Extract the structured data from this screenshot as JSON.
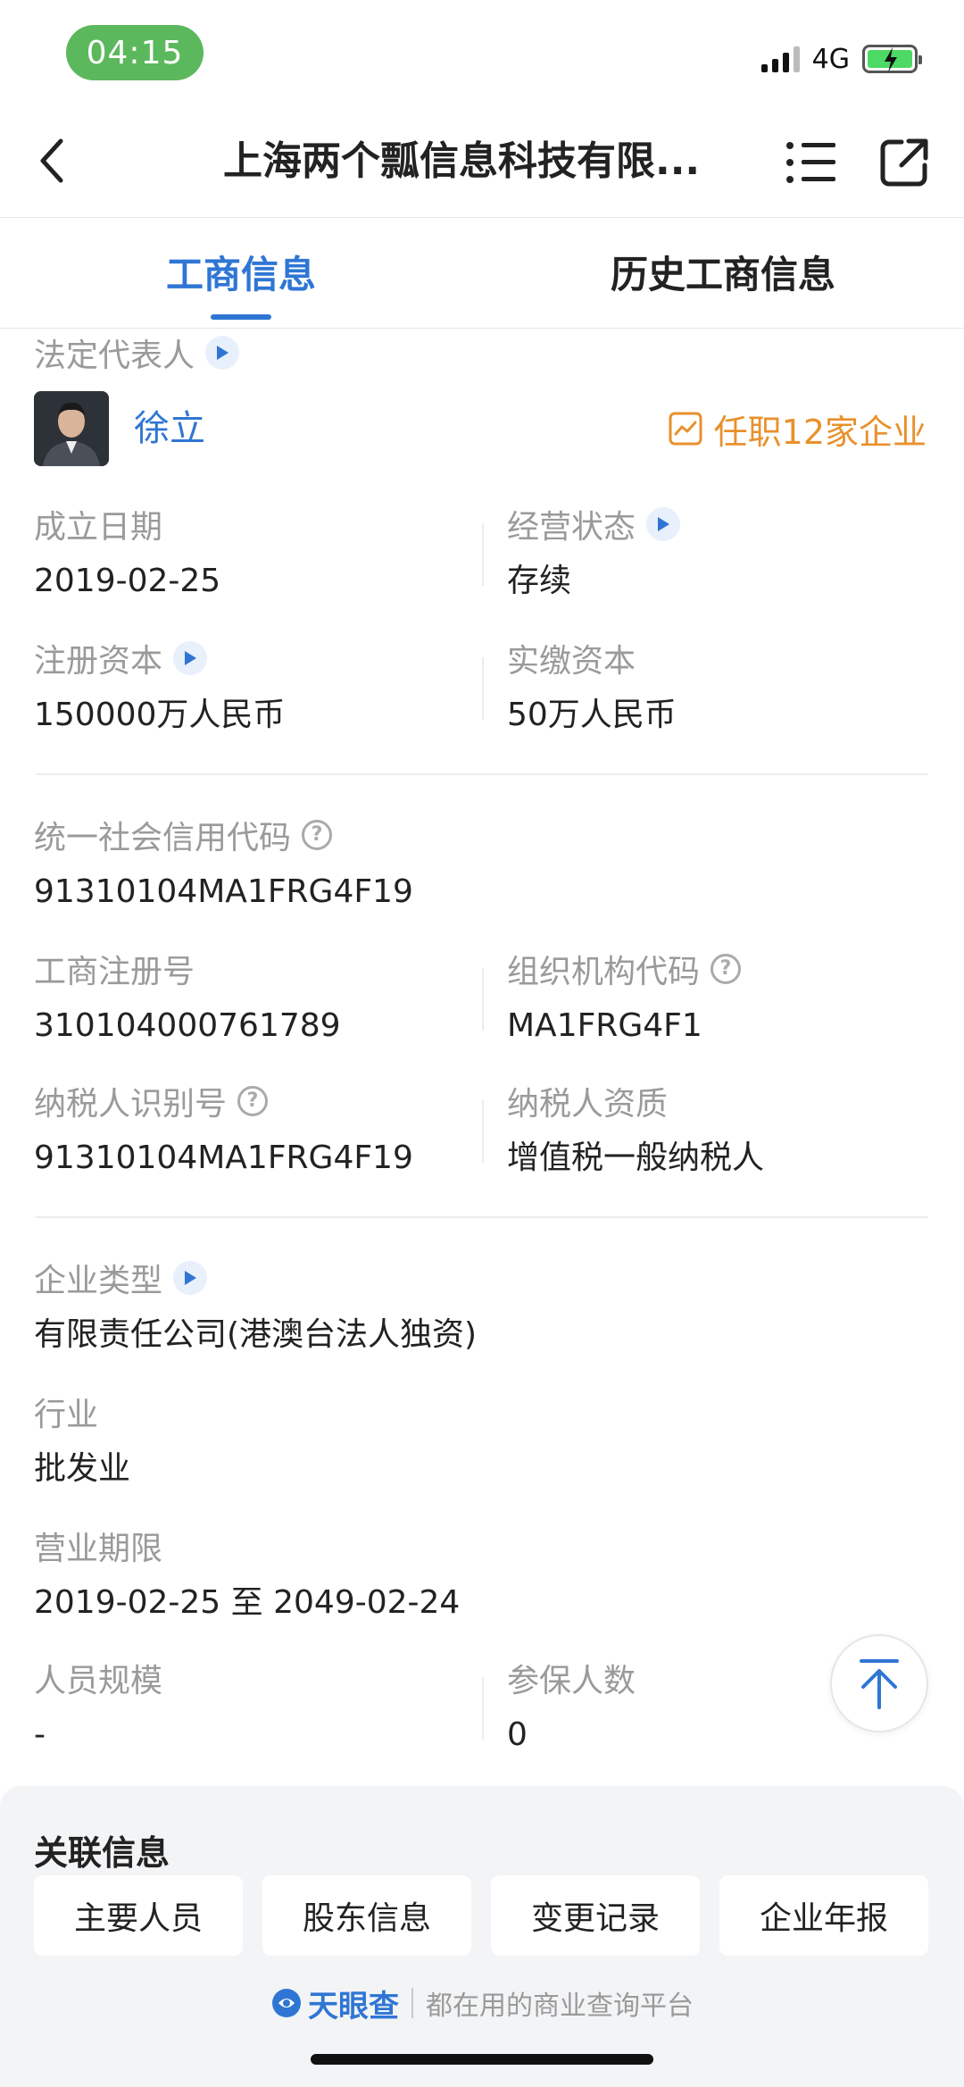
{
  "status_bar": {
    "time": "04:15",
    "network": "4G"
  },
  "nav": {
    "title": "上海两个瓢信息科技有限..."
  },
  "tabs": {
    "active": "工商信息",
    "inactive": "历史工商信息"
  },
  "legal_rep": {
    "label": "法定代表人",
    "name": "徐立",
    "jobs": "任职12家企业"
  },
  "fields": {
    "established_date": {
      "label": "成立日期",
      "value": "2019-02-25"
    },
    "operating_status": {
      "label": "经营状态",
      "value": "存续"
    },
    "registered_capital": {
      "label": "注册资本",
      "value": "150000万人民币"
    },
    "paid_capital": {
      "label": "实缴资本",
      "value": "50万人民币"
    },
    "credit_code": {
      "label": "统一社会信用代码",
      "value": "91310104MA1FRG4F19"
    },
    "reg_number": {
      "label": "工商注册号",
      "value": "310104000761789"
    },
    "org_code": {
      "label": "组织机构代码",
      "value": "MA1FRG4F1"
    },
    "taxpayer_id": {
      "label": "纳税人识别号",
      "value": "91310104MA1FRG4F19"
    },
    "taxpayer_type": {
      "label": "纳税人资质",
      "value": "增值税一般纳税人"
    },
    "company_type": {
      "label": "企业类型",
      "value": "有限责任公司(港澳台法人独资)"
    },
    "industry": {
      "label": "行业",
      "value": "批发业"
    },
    "business_term": {
      "label": "营业期限",
      "value": "2019-02-25 至 2049-02-24"
    },
    "staff_size": {
      "label": "人员规模",
      "value": "-"
    },
    "insured_count": {
      "label": "参保人数",
      "value": "0"
    }
  },
  "related": {
    "title": "关联信息",
    "buttons": [
      "主要人员",
      "股东信息",
      "变更记录",
      "企业年报"
    ],
    "brand": "天眼查",
    "slogan": "都在用的商业查询平台"
  },
  "colors": {
    "accent": "#2f76d4",
    "orange": "#e8912d",
    "time_pill": "#5cb85c"
  }
}
